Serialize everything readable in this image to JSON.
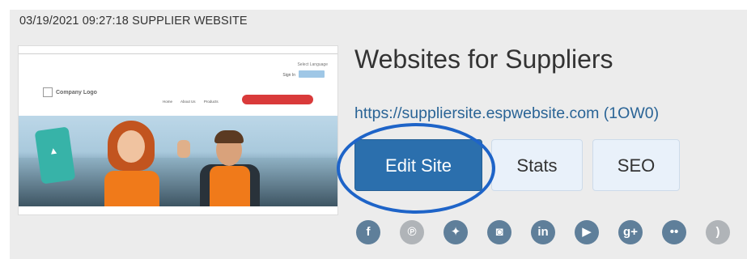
{
  "timestamp": "03/19/2021 09:27:18 SUPPLIER WEBSITE",
  "thumbnail": {
    "language_label": "Select Language",
    "signin_label": "Sign In",
    "logo_text": "Company Logo",
    "nav_items": [
      "Home",
      "About Us",
      "Products"
    ]
  },
  "title": "Websites for Suppliers",
  "url": "https://suppliersite.espwebsite.com (1OW0)",
  "buttons": {
    "edit": "Edit Site",
    "stats": "Stats",
    "seo": "SEO"
  },
  "social_icons": [
    {
      "name": "facebook-icon",
      "glyph": "f"
    },
    {
      "name": "pinterest-icon",
      "glyph": "℗"
    },
    {
      "name": "twitter-icon",
      "glyph": "✦"
    },
    {
      "name": "instagram-icon",
      "glyph": "◙"
    },
    {
      "name": "linkedin-icon",
      "glyph": "in"
    },
    {
      "name": "youtube-icon",
      "glyph": "▶"
    },
    {
      "name": "googleplus-icon",
      "glyph": "g+"
    },
    {
      "name": "flickr-icon",
      "glyph": "••"
    },
    {
      "name": "rss-icon",
      "glyph": ")"
    }
  ],
  "colors": {
    "edit_button": "#2b6fad",
    "highlight_circle": "#1e64c8",
    "link": "#2a6496"
  }
}
